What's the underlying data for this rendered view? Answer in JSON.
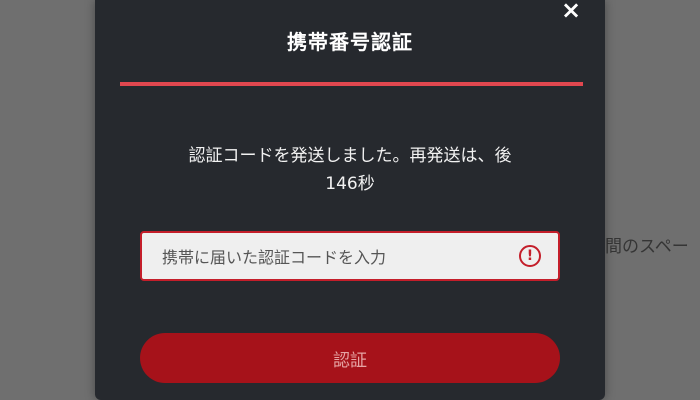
{
  "background": {
    "text": "の間のスペー"
  },
  "modal": {
    "title": "携帯番号認証",
    "message_line1": "認証コードを発送しました。再発送は、後",
    "message_line2": "146秒",
    "countdown_seconds": 146,
    "input": {
      "value": "",
      "placeholder": "携帯に届いた認証コードを入力",
      "state": "error"
    },
    "submit_label": "認証",
    "close_symbol": "×"
  },
  "icons": {
    "close": "close-icon",
    "error": "error-icon"
  },
  "colors": {
    "modal_bg": "#26292e",
    "accent_red": "#e0474f",
    "error_red": "#c41e2a",
    "button_bg": "#a6121a",
    "button_text": "#e6a4a4",
    "backdrop": "#6f6f6f"
  }
}
